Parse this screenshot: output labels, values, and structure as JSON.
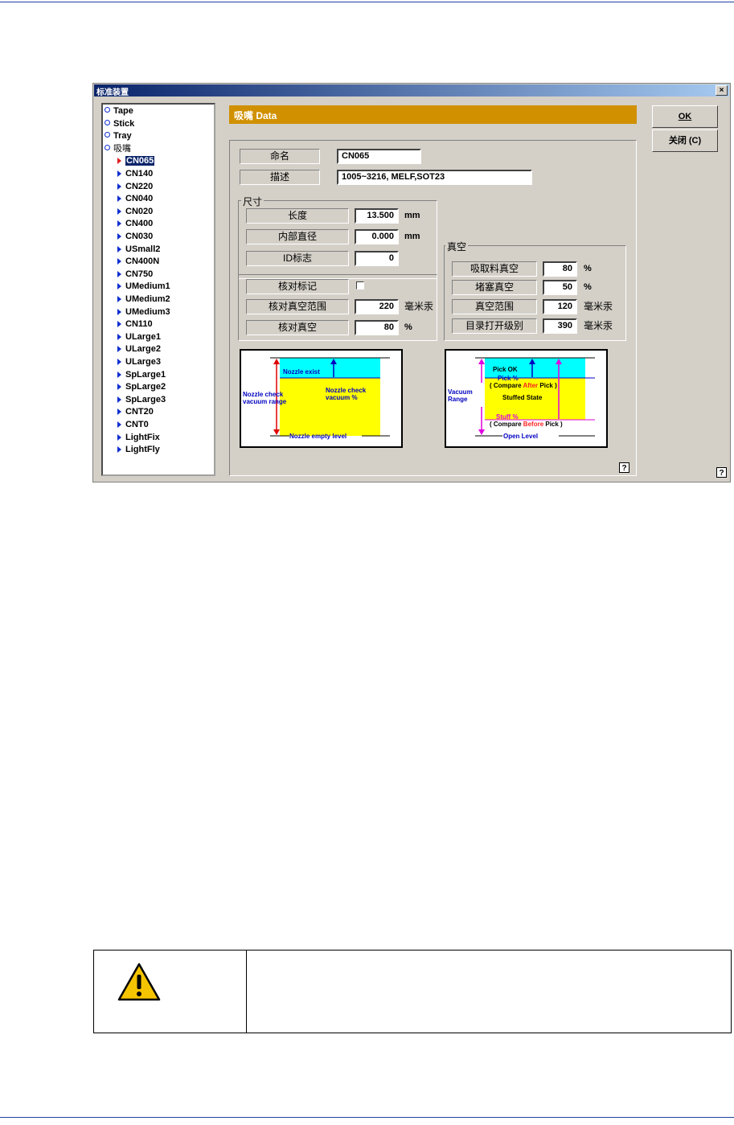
{
  "dialog": {
    "title": "标准装置",
    "close_glyph": "×"
  },
  "tree": {
    "top_items": [
      {
        "label": "Tape"
      },
      {
        "label": "Stick"
      },
      {
        "label": "Tray"
      },
      {
        "label": "吸嘴"
      }
    ],
    "nozzles": [
      {
        "label": "CN065",
        "selected": true
      },
      {
        "label": "CN140"
      },
      {
        "label": "CN220"
      },
      {
        "label": "CN040"
      },
      {
        "label": "CN020"
      },
      {
        "label": "CN400"
      },
      {
        "label": "CN030"
      },
      {
        "label": "USmall2"
      },
      {
        "label": "CN400N"
      },
      {
        "label": "CN750"
      },
      {
        "label": "UMedium1"
      },
      {
        "label": "UMedium2"
      },
      {
        "label": "UMedium3"
      },
      {
        "label": "CN110"
      },
      {
        "label": "ULarge1"
      },
      {
        "label": "ULarge2"
      },
      {
        "label": "ULarge3"
      },
      {
        "label": "SpLarge1"
      },
      {
        "label": "SpLarge2"
      },
      {
        "label": "SpLarge3"
      },
      {
        "label": "CNT20"
      },
      {
        "label": "CNT0"
      },
      {
        "label": "LightFix"
      },
      {
        "label": "LightFly"
      }
    ]
  },
  "header": {
    "title": "吸嘴 Data",
    "color": "#d09000"
  },
  "form": {
    "name_label": "命名",
    "name_value": "CN065",
    "desc_label": "描述",
    "desc_value": "1005~3216, MELF,SOT23",
    "size_group": "尺寸",
    "length_label": "长度",
    "length_value": "13.500",
    "length_unit": "mm",
    "inner_label": "内部直径",
    "inner_value": "0.000",
    "inner_unit": "mm",
    "id_label": "ID标志",
    "id_value": "0",
    "check_mark_label": "核对标记",
    "check_mark_checked": false,
    "check_range_label": "核对真空范围",
    "check_range_value": "220",
    "check_range_unit": "毫米汞",
    "check_vac_label": "核对真空",
    "check_vac_value": "80",
    "check_vac_unit": "%",
    "vac_group": "真空",
    "pick_vac_label": "吸取料真空",
    "pick_vac_value": "80",
    "pick_vac_unit": "%",
    "stuff_vac_label": "堵塞真空",
    "stuff_vac_value": "50",
    "stuff_vac_unit": "%",
    "vac_range_label": "真空范围",
    "vac_range_value": "120",
    "vac_range_unit": "毫米汞",
    "open_level_label": "目录打开级别",
    "open_level_value": "390",
    "open_level_unit": "毫米汞"
  },
  "buttons": {
    "ok": "OK",
    "close": "关闭 (C)",
    "help": "?"
  },
  "diagram_left": {
    "nozzle_exist": "Nozzle exist",
    "check_range": [
      "Nozzle check",
      "vacuum range"
    ],
    "check_pct": [
      "Nozzle check",
      "vacuum %"
    ],
    "empty_level": "Nozzle empty level"
  },
  "diagram_right": {
    "pick_ok": "Pick OK",
    "pick_pct": "Pick %",
    "compare_after": [
      "( Compare ",
      "After",
      " Pick )"
    ],
    "stuffed_state": "Stuffed State",
    "vacuum_range": [
      "Vacuum",
      "Range"
    ],
    "stuff_pct": "Stuff %",
    "compare_before": [
      "( Compare ",
      "Before",
      " Pick )"
    ],
    "open_level": "Open Level"
  },
  "colors": {
    "cyan": "#00ffff",
    "yellow": "#ffff00",
    "arrow_red": "#e00000",
    "arrow_blue": "#0000c0",
    "accent_red": "#ff2020",
    "magenta": "#e000e0"
  },
  "warning": {
    "icon": "warning-triangle-icon"
  }
}
